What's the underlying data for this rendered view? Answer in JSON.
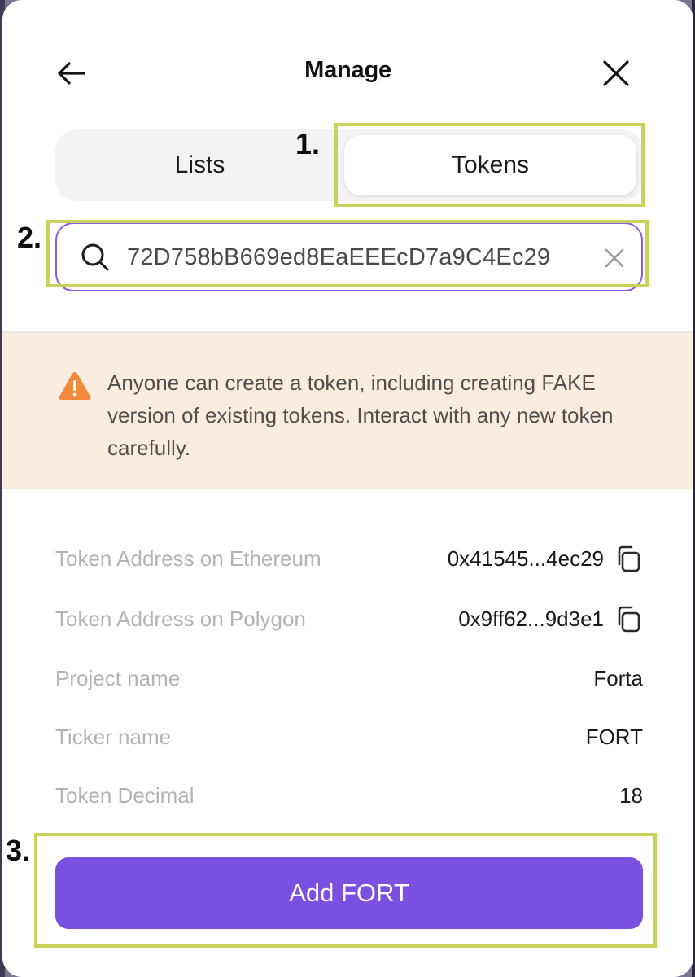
{
  "header": {
    "title": "Manage"
  },
  "tabs": [
    {
      "label": "Lists",
      "active": false
    },
    {
      "label": "Tokens",
      "active": true
    }
  ],
  "search": {
    "value": "72D758bB669ed8EaEEEcD7a9C4Ec29",
    "placeholder": ""
  },
  "warning": {
    "text": "Anyone can create a token, including creating FAKE version of existing tokens. Interact with any new token carefully."
  },
  "details": [
    {
      "label": "Token Address on Ethereum",
      "value": "0x41545...4ec29",
      "copyable": true
    },
    {
      "label": "Token Address on Polygon",
      "value": "0x9ff62...9d3e1",
      "copyable": true
    },
    {
      "label": "Project name",
      "value": "Forta",
      "copyable": false
    },
    {
      "label": "Ticker name",
      "value": "FORT",
      "copyable": false
    },
    {
      "label": "Token Decimal",
      "value": "18",
      "copyable": false
    }
  ],
  "action": {
    "label": "Add FORT"
  },
  "annotations": {
    "step1": "1.",
    "step2": "2.",
    "step3": "3."
  },
  "colors": {
    "accent": "#7b4fe0",
    "search_border": "#8a5ce6",
    "warning_bg": "#fbece0",
    "warning_icon": "#f28a3c",
    "highlight": "#c9d35a"
  },
  "icons": {
    "back": "arrow-left-icon",
    "close": "close-icon",
    "search": "search-icon",
    "clear": "clear-icon",
    "warning": "warning-triangle-icon",
    "copy": "copy-icon"
  }
}
